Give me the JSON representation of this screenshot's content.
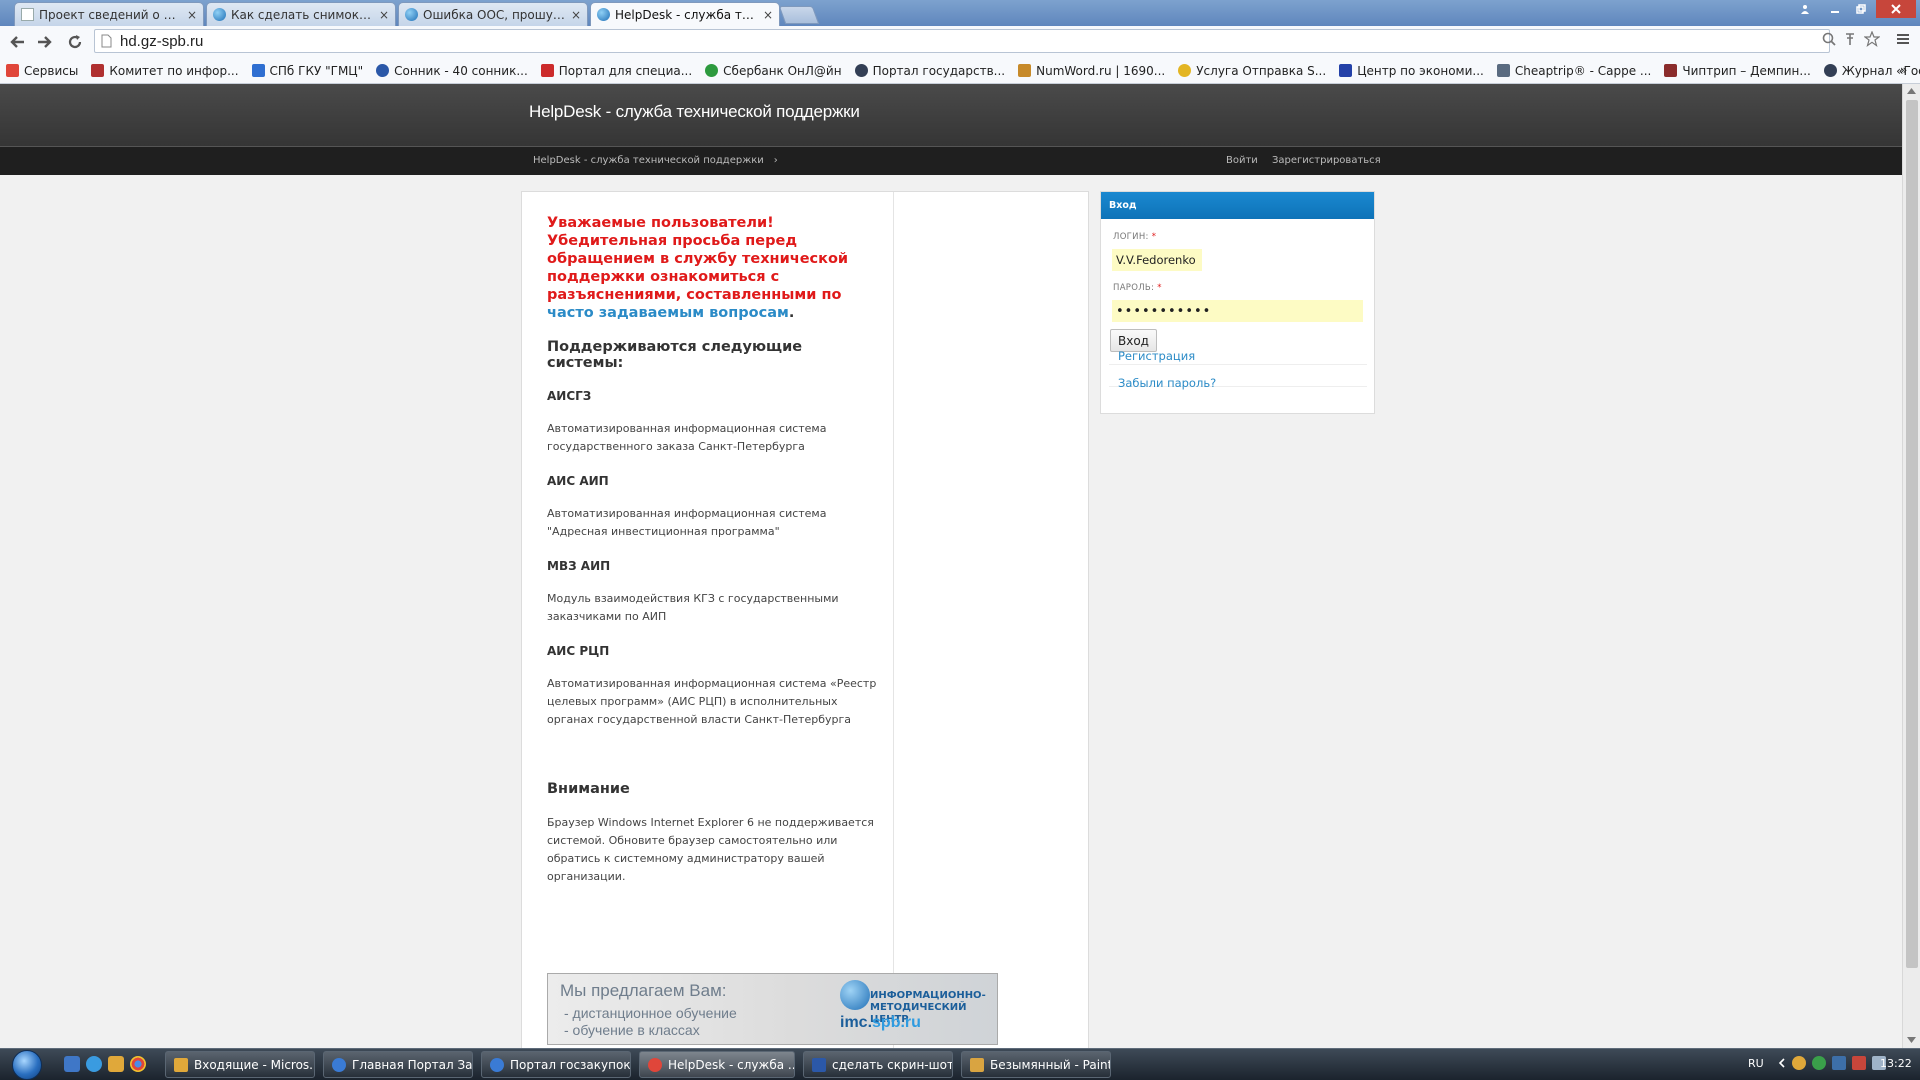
{
  "browser": {
    "tabs": [
      {
        "label": "Проект сведений о внесе",
        "active": false
      },
      {
        "label": "Как сделать снимок экра",
        "active": false
      },
      {
        "label": "Ошибка ООС, прошу по",
        "active": false
      },
      {
        "label": "HelpDesk - служба техни",
        "active": true
      }
    ],
    "tab_close_glyph": "×",
    "url": "hd.gz-spb.ru",
    "bookmarks": [
      {
        "label": "Сервисы",
        "color": "#e0463a"
      },
      {
        "label": "Комитет по инфор...",
        "color": "#b03030"
      },
      {
        "label": "СПб ГКУ \"ГМЦ\"",
        "color": "#2f6fd1"
      },
      {
        "label": "Сонник - 40 сонник...",
        "color": "#2b58a8"
      },
      {
        "label": "Портал для специа...",
        "color": "#cc2b2b"
      },
      {
        "label": "Сбербанк ОнЛ@йн",
        "color": "#2d9a3e"
      },
      {
        "label": "Портал государств...",
        "color": "#333f55"
      },
      {
        "label": "NumWord.ru | 1690...",
        "color": "#c78a2a"
      },
      {
        "label": "Услуга Отправка S...",
        "color": "#e3b523"
      },
      {
        "label": "Центр по экономи...",
        "color": "#2441a8"
      },
      {
        "label": "Cheaptrip® - Сарре ...",
        "color": "#5a6b80"
      },
      {
        "label": "Чиптрип – Демпин...",
        "color": "#8b2c2c"
      },
      {
        "label": "Журнал «Госзакупк...",
        "color": "#333f55"
      }
    ],
    "bookmarks_more": "»"
  },
  "site": {
    "title": "HelpDesk - служба технической поддержки",
    "breadcrumb": "HelpDesk - служба технической поддержки",
    "breadcrumb_sep": "›",
    "nav_login": "Войти",
    "nav_register": "Зарегистрироваться"
  },
  "content": {
    "notice_text": "Уважаемые пользователи! Убедительная просьба перед обращением в службу технической поддержки ознакомиться с разъяснениями, составленными по ",
    "notice_link": "часто задаваемым вопросам",
    "notice_end": ".",
    "systems_heading": "Поддерживаются следующие системы:",
    "systems": [
      {
        "name": "АИСГЗ",
        "desc": "Автоматизированная информационная система государственного заказа Санкт-Петербурга"
      },
      {
        "name": "АИС АИП",
        "desc": "Автоматизированная информационная система \"Адресная инвестиционная программа\""
      },
      {
        "name": "МВЗ АИП",
        "desc": "Модуль взаимодействия КГЗ с государственными заказчиками по АИП"
      },
      {
        "name": "АИС РЦП",
        "desc": "Автоматизированная информационная система «Реестр целевых программ» (АИС РЦП) в исполнительных органах государственной власти Санкт-Петербурга"
      }
    ],
    "warning_heading": "Внимание",
    "warning_text": "Браузер Windows Internet Explorer 6 не поддерживается системой. Обновите браузер самостоятельно или обратись к системному администратору вашей организации."
  },
  "banner": {
    "lead": "Мы предлагаем Вам:",
    "item1": "- дистанционное обучение",
    "item2": "- обучение в классах",
    "org": "ИНФОРМАЦИОННО-МЕТОДИЧЕСКИЙ ЦЕНТР",
    "site_a": "imc.",
    "site_b": "spb.ru"
  },
  "login": {
    "heading": "Вход",
    "login_label": "ЛОГИН:",
    "login_value": "V.V.Fedorenko",
    "password_label": "ПАРОЛЬ:",
    "password_value": "•••••••••••",
    "required_mark": "*",
    "submit": "Вход",
    "register_link": "Регистрация",
    "forgot_link": "Забыли пароль?"
  },
  "taskbar": {
    "items": [
      {
        "label": "Входящие - Micros...",
        "color": "#e0a83a",
        "active": false
      },
      {
        "label": "Главная Портал За...",
        "color": "#3a7bd5",
        "active": false
      },
      {
        "label": "Портал госзакупок...",
        "color": "#3a7bd5",
        "active": false
      },
      {
        "label": "HelpDesk - служба ...",
        "color": "#e0463a",
        "active": true
      },
      {
        "label": "сделать скрин-шот...",
        "color": "#2b58a8",
        "active": false
      },
      {
        "label": "Безымянный - Paint",
        "color": "#d9a441",
        "active": false
      }
    ],
    "lang": "RU",
    "clock": "13:22"
  }
}
